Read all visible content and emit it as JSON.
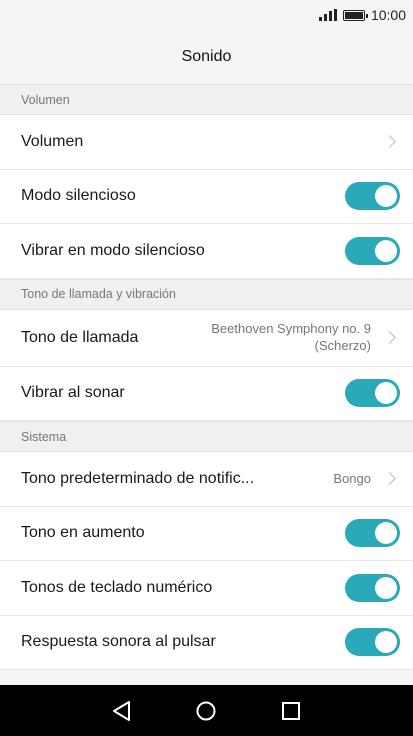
{
  "status": {
    "time": "10:00"
  },
  "header": {
    "title": "Sonido"
  },
  "sections": {
    "volumen": {
      "title": "Volumen",
      "items": {
        "volumen": {
          "label": "Volumen"
        },
        "modo_silencioso": {
          "label": "Modo silencioso",
          "toggle": true
        },
        "vibrar_silencioso": {
          "label": "Vibrar en modo silencioso",
          "toggle": true
        }
      }
    },
    "tono": {
      "title": "Tono de llamada y vibración",
      "items": {
        "tono_llamada": {
          "label": "Tono de llamada",
          "value_line1": "Beethoven Symphony no. 9",
          "value_line2": "(Scherzo)"
        },
        "vibrar_sonar": {
          "label": "Vibrar al sonar",
          "toggle": true
        }
      }
    },
    "sistema": {
      "title": "Sistema",
      "items": {
        "tono_notif": {
          "label": "Tono predeterminado de notific...",
          "value": "Bongo"
        },
        "tono_aumento": {
          "label": "Tono en aumento",
          "toggle": true
        },
        "tonos_teclado": {
          "label": "Tonos de teclado numérico",
          "toggle": true
        },
        "respuesta_sonora": {
          "label": "Respuesta sonora al pulsar",
          "toggle": true
        }
      }
    }
  },
  "colors": {
    "toggle_on": "#2aa9b8",
    "nav_bar": "#000000"
  },
  "nav": {
    "back": "back-icon",
    "home": "home-icon",
    "recents": "recents-icon"
  }
}
